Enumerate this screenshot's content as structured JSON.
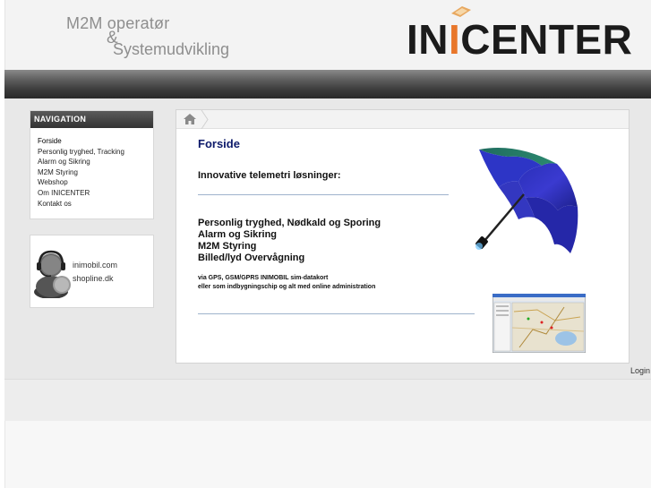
{
  "header": {
    "tagline_line1": "M2M operatør",
    "tagline_amp": "&",
    "tagline_line2": "Systemudvikling",
    "logo_part1": "IN",
    "logo_part2": "I",
    "logo_part3": "CENTER",
    "logo_accent_color": "#e8762a"
  },
  "navigation": {
    "title": "NAVIGATION",
    "items": [
      {
        "label": "Forside"
      },
      {
        "label": "Personlig tryghed, Tracking"
      },
      {
        "label": "Alarm og Sikring"
      },
      {
        "label": "M2M Styring"
      },
      {
        "label": "Webshop"
      },
      {
        "label": "Om INICENTER"
      },
      {
        "label": "Kontakt os"
      }
    ]
  },
  "contact": {
    "icon": "support-headset-icon",
    "link1": "inimobil.com",
    "link2": "shopline.dk"
  },
  "breadcrumb": {
    "home_icon": "home-icon"
  },
  "content": {
    "title": "Forside",
    "title_color": "#0d1a6a",
    "subtitle": "Innovative telemetri løsninger:",
    "features": [
      "Personlig tryghed, Nødkald og Sporing",
      "Alarm og Sikring",
      "M2M Styring",
      "Billed/lyd Overvågning"
    ],
    "fine_print_1": "via GPS, GSM/GPRS INIMOBIL sim-datakort",
    "fine_print_2": "eller som indbygningschip og alt med online administration"
  },
  "footer": {
    "login_label": "Login"
  }
}
